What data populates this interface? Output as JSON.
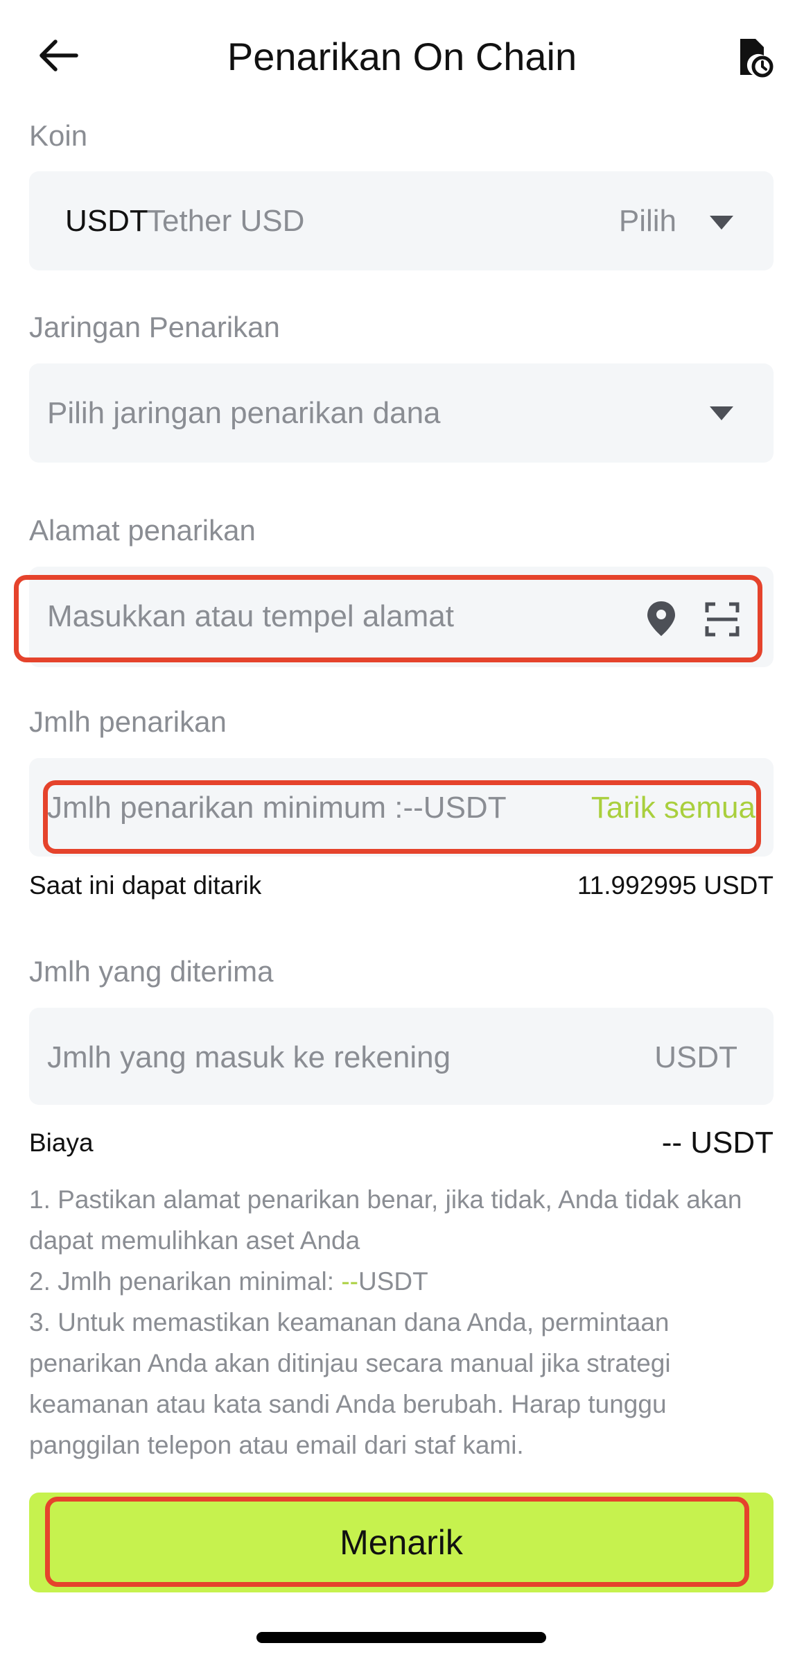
{
  "header": {
    "title": "Penarikan On Chain"
  },
  "coin": {
    "label": "Koin",
    "symbol": "USDT",
    "name": "Tether USD",
    "pick_label": "Pilih"
  },
  "network": {
    "label": "Jaringan Penarikan",
    "placeholder": "Pilih jaringan penarikan dana"
  },
  "address": {
    "label": "Alamat penarikan",
    "placeholder": "Masukkan atau tempel alamat"
  },
  "amount": {
    "label": "Jmlh penarikan",
    "placeholder": "Jmlh penarikan minimum :--USDT",
    "withdraw_all": "Tarik semua",
    "available_label": "Saat ini dapat ditarik",
    "available_value": "11.992995 USDT"
  },
  "receive": {
    "label": "Jmlh yang diterima",
    "placeholder": "Jmlh yang masuk ke rekening",
    "unit": "USDT"
  },
  "fee": {
    "label": "Biaya",
    "value": "-- USDT"
  },
  "notes": {
    "line1": "1. Pastikan alamat penarikan benar, jika tidak, Anda tidak akan dapat memulihkan aset Anda",
    "line2_prefix": "2. Jmlh penarikan minimal: ",
    "line2_value": "--",
    "line2_unit": "USDT",
    "line3": "3. Untuk memastikan keamanan dana Anda, permintaan penarikan Anda akan ditinjau secara manual jika strategi keamanan atau kata sandi Anda berubah. Harap tunggu panggilan telepon atau email dari staf kami."
  },
  "submit": {
    "label": "Menarik"
  },
  "colors": {
    "accent": "#c6f24e",
    "accent_text": "#a9cf3d",
    "highlight": "#e5432c",
    "field_bg": "#f4f6f8"
  },
  "icons": {
    "back": "arrow-left-icon",
    "history": "history-document-icon",
    "location": "location-pin-icon",
    "scan": "scan-icon",
    "dropdown": "caret-down-icon"
  }
}
